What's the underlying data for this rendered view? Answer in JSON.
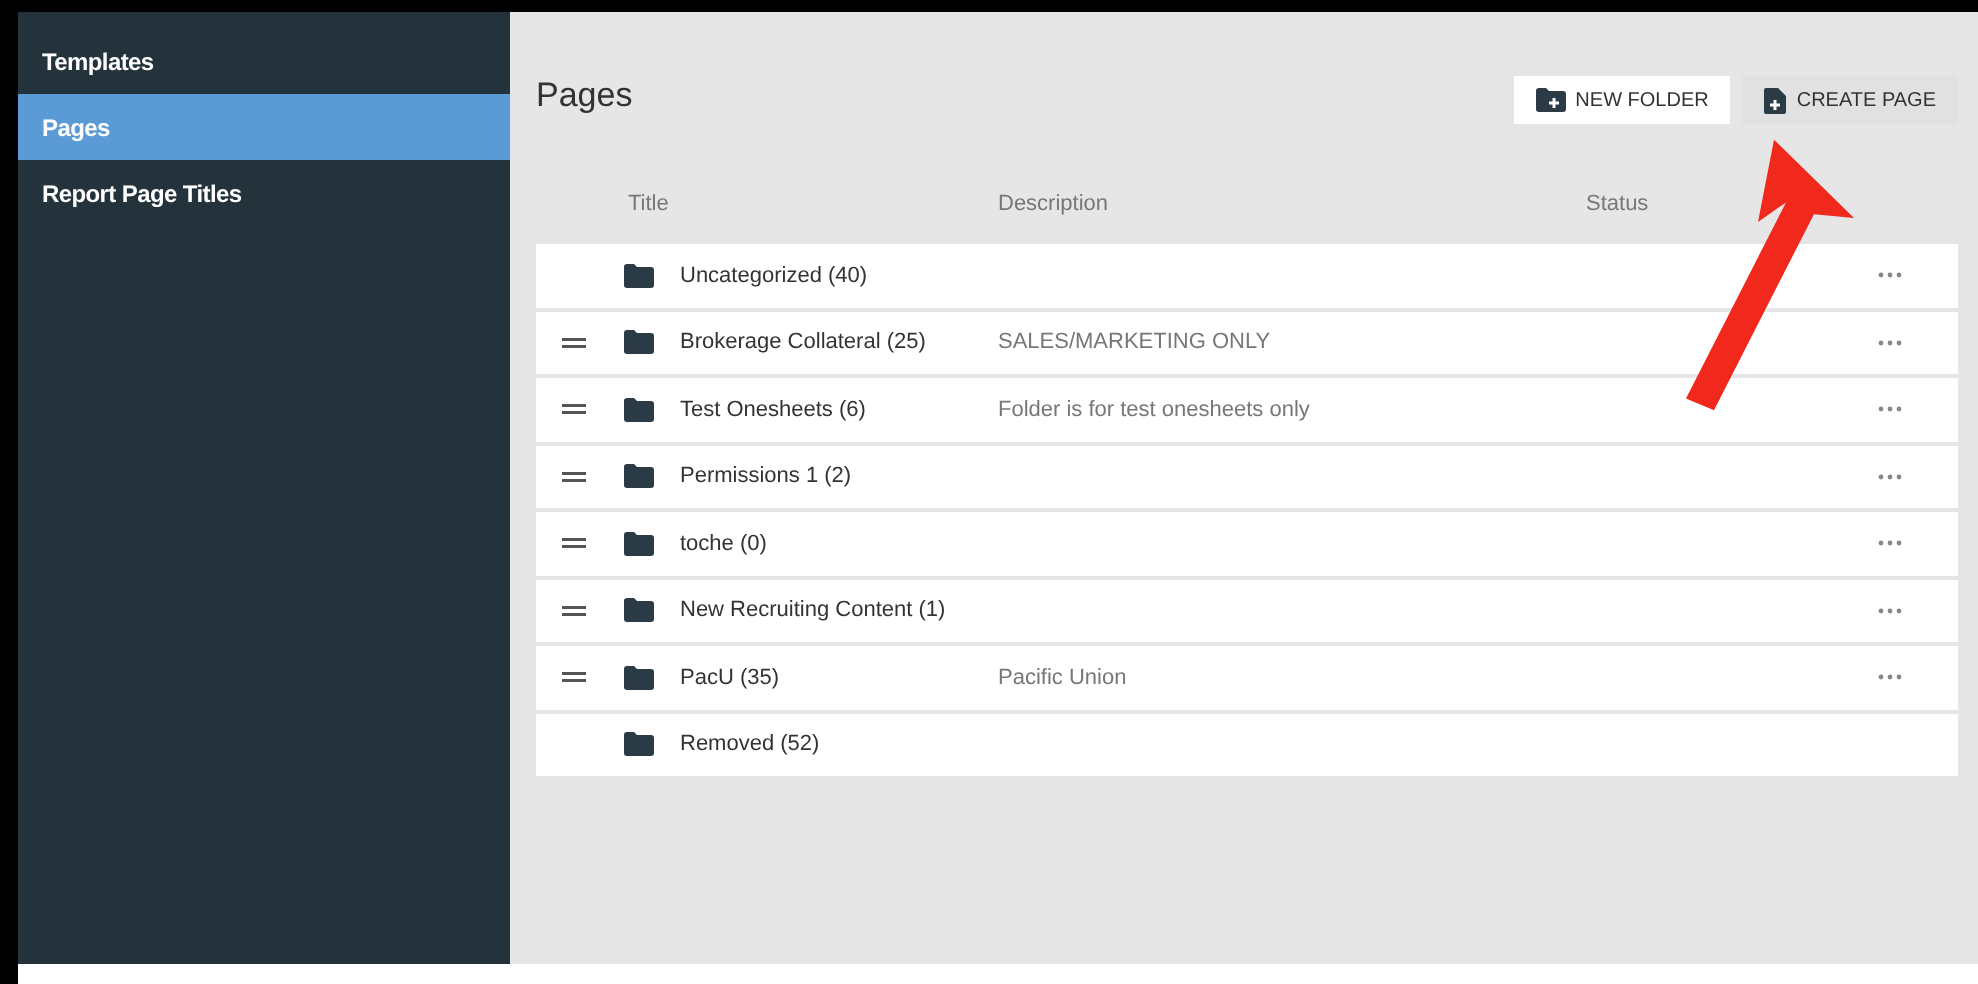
{
  "sidebar": {
    "items": [
      {
        "label": "Templates",
        "selected": false
      },
      {
        "label": "Pages",
        "selected": true
      },
      {
        "label": "Report Page Titles",
        "selected": false
      }
    ]
  },
  "page_title": "Pages",
  "buttons": [
    {
      "label": "NEW FOLDER",
      "kind": "folder",
      "selected": true
    },
    {
      "label": "CREATE PAGE",
      "kind": "page",
      "selected": false
    }
  ],
  "table": {
    "columns": [
      "Title",
      "Description",
      "Status"
    ],
    "rows": [
      {
        "title": "Uncategorized (40)",
        "description": "",
        "draggable": false,
        "menu": true
      },
      {
        "title": "Brokerage Collateral (25)",
        "description": "SALES/MARKETING ONLY",
        "draggable": true,
        "menu": true
      },
      {
        "title": "Test Onesheets (6)",
        "description": "Folder is for test onesheets only",
        "draggable": true,
        "menu": true
      },
      {
        "title": "Permissions 1 (2)",
        "description": "",
        "draggable": true,
        "menu": true
      },
      {
        "title": "toche (0)",
        "description": "",
        "draggable": true,
        "menu": true
      },
      {
        "title": "New Recruiting Content (1)",
        "description": "",
        "draggable": true,
        "menu": true
      },
      {
        "title": "PacU (35)",
        "description": "Pacific Union",
        "draggable": true,
        "menu": true
      },
      {
        "title": "Removed (52)",
        "description": "",
        "draggable": false,
        "menu": false
      }
    ]
  }
}
